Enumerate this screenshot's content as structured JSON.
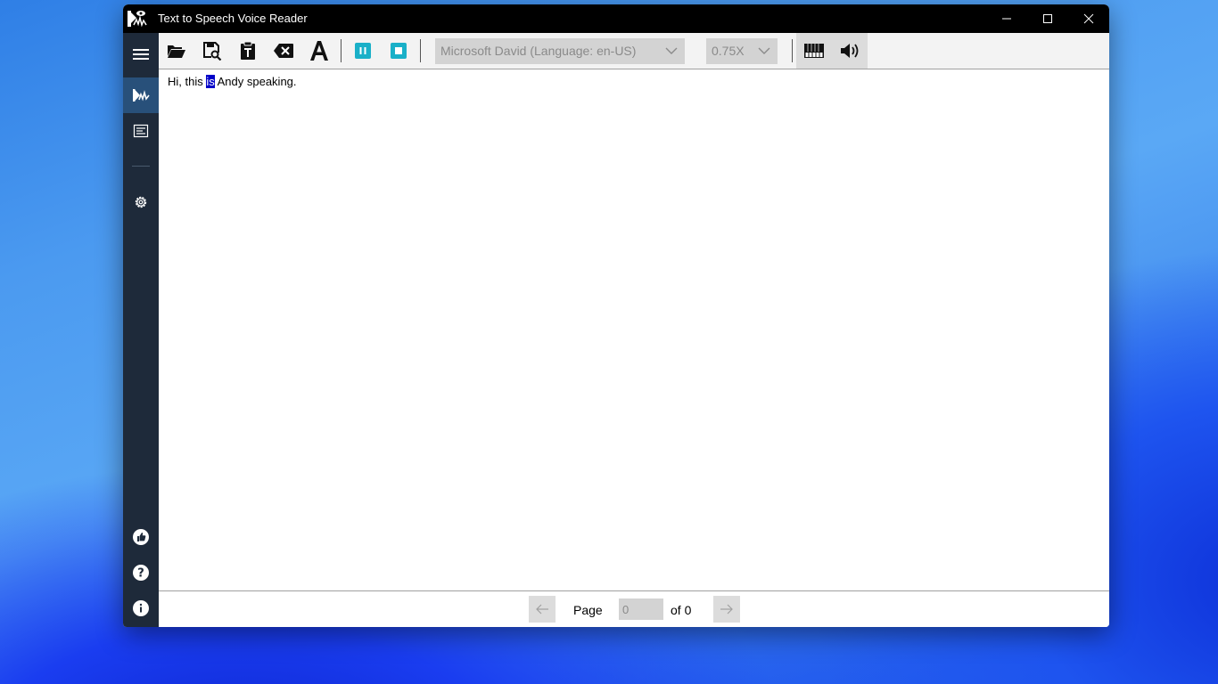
{
  "window": {
    "title": "Text to Speech Voice Reader"
  },
  "toolbar": {
    "icons": [
      "folder-open-icon",
      "save-search-icon",
      "clipboard-text-icon",
      "clear-icon",
      "font-icon",
      "pause-icon",
      "stop-icon",
      "piano-keys-icon",
      "volume-icon"
    ],
    "voice_value": "Microsoft David (Language: en-US)",
    "speed_value": "0.75X"
  },
  "sidebar": {
    "icons": [
      "menu-icon",
      "speech-icon",
      "text-list-icon",
      "settings-icon",
      "thumbs-up-icon",
      "help-icon",
      "info-icon"
    ]
  },
  "content": {
    "text_before": "Hi, this ",
    "text_highlight": "is",
    "text_after": " Andy speaking."
  },
  "pager": {
    "page_label": "Page",
    "page_value": "0",
    "of_label": "of 0"
  },
  "colors": {
    "accent": "#1ab0c8",
    "sidebar": "#1e2a3a",
    "sidebar_active": "#28507a",
    "highlight": "#0000c8"
  }
}
